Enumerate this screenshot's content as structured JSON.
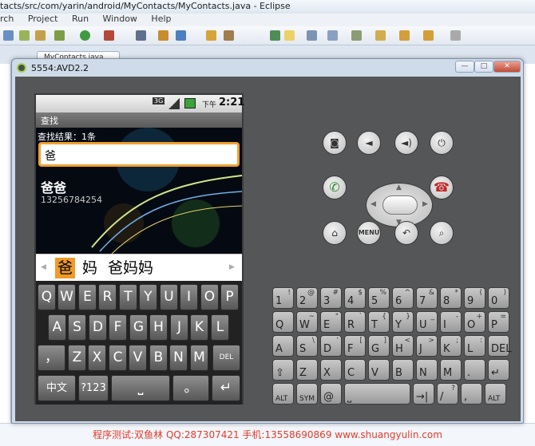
{
  "eclipse": {
    "title": "tacts/src/com/yarin/android/MyContacts/MyContacts.java - Eclipse",
    "menu": [
      "rch",
      "Project",
      "Run",
      "Window",
      "Help"
    ],
    "editor_tab": "MyContacts.java"
  },
  "emulator": {
    "title": "5554:AVD2.2",
    "window_buttons": [
      "—",
      "□",
      "✕"
    ]
  },
  "phone": {
    "status": {
      "network": "3G",
      "time_prefix": "下午",
      "time": "2:21"
    },
    "app_title": "查找",
    "result_text": "查找结果：1条",
    "search_value": "爸",
    "contact": {
      "name": "爸爸",
      "phone": "13256784254"
    },
    "candidates": [
      "爸",
      "妈",
      "爸妈妈"
    ],
    "keyboard": {
      "row1": [
        "Q",
        "W",
        "E",
        "R",
        "T",
        "Y",
        "U",
        "I",
        "O",
        "P"
      ],
      "row2": [
        "A",
        "S",
        "D",
        "F",
        "G",
        "H",
        "J",
        "K",
        "L"
      ],
      "row3": [
        "，",
        "Z",
        "X",
        "C",
        "V",
        "B",
        "N",
        "M",
        "DEL"
      ],
      "row4": [
        "中文",
        "?123",
        "⎵",
        "。",
        "↵"
      ]
    }
  },
  "hardware_buttons": {
    "camera": "camera-icon",
    "vol_down": "volume-down-icon",
    "vol_up": "volume-up-icon",
    "power": "power-icon",
    "call": "call-icon",
    "end_call": "end-call-icon",
    "home": "home-icon",
    "menu": "MENU",
    "back": "back-icon",
    "search": "search-icon"
  },
  "hardware_keyboard": {
    "row1": [
      [
        "1",
        "!"
      ],
      [
        "2",
        "@"
      ],
      [
        "3",
        "#"
      ],
      [
        "4",
        "$"
      ],
      [
        "5",
        "%"
      ],
      [
        "6",
        "^"
      ],
      [
        "7",
        "&"
      ],
      [
        "8",
        "*"
      ],
      [
        "9",
        "("
      ],
      [
        "0",
        ")"
      ]
    ],
    "row2": [
      [
        "Q",
        ""
      ],
      [
        "W",
        "~"
      ],
      [
        "E",
        "\""
      ],
      [
        "R",
        "`"
      ],
      [
        "T",
        "{"
      ],
      [
        "Y",
        "}"
      ],
      [
        "U",
        "_"
      ],
      [
        "I",
        "-"
      ],
      [
        "O",
        "+"
      ],
      [
        "P",
        "="
      ]
    ],
    "row3": [
      [
        "A",
        ""
      ],
      [
        "S",
        "\\"
      ],
      [
        "D",
        "'"
      ],
      [
        "F",
        "["
      ],
      [
        "G",
        "]"
      ],
      [
        "H",
        "<"
      ],
      [
        "J",
        ">"
      ],
      [
        "K",
        ";"
      ],
      [
        "L",
        ":"
      ],
      [
        "DEL",
        ""
      ]
    ],
    "row4": [
      [
        "⇧",
        ""
      ],
      [
        "Z",
        ""
      ],
      [
        "X",
        ""
      ],
      [
        "C",
        ""
      ],
      [
        "V",
        ""
      ],
      [
        "B",
        ""
      ],
      [
        "N",
        ""
      ],
      [
        "M",
        ""
      ],
      [
        ".",
        ""
      ],
      [
        "↵",
        ""
      ]
    ],
    "row5": [
      [
        "ALT",
        ""
      ],
      [
        "SYM",
        ""
      ],
      [
        "@",
        ""
      ],
      [
        "⎵",
        ""
      ],
      [
        "→|",
        ""
      ],
      [
        "/",
        "?"
      ],
      [
        ",",
        ""
      ],
      [
        "ALT",
        ""
      ]
    ]
  },
  "footer": "程序测试:双鱼林 QQ:287307421 手机:13558690869 www.shuangyulin.com"
}
